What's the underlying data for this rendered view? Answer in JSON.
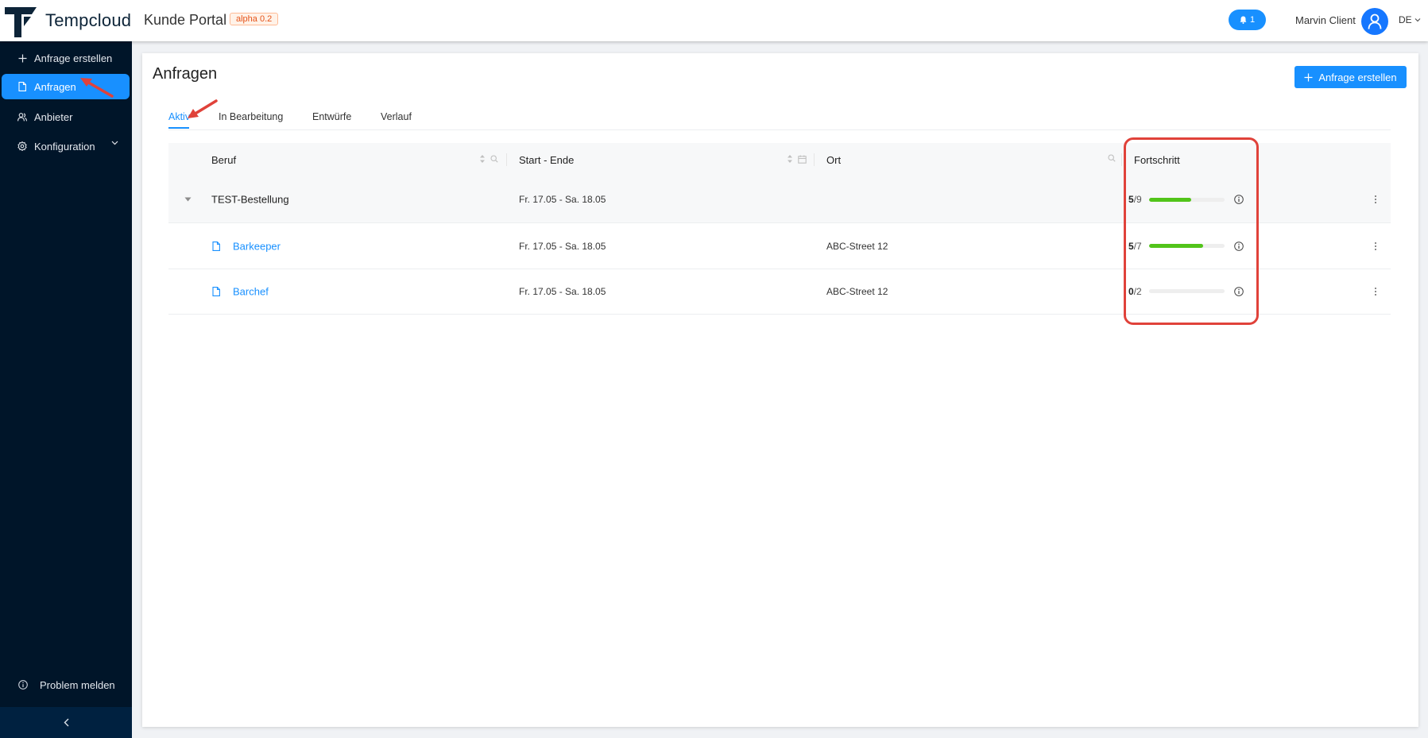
{
  "header": {
    "brand": "Tempcloud",
    "portal": "Kunde Portal",
    "version_badge": "alpha 0.2",
    "notifications_count": "1",
    "user_name": "Marvin Client",
    "language": "DE"
  },
  "sidebar": {
    "items": [
      {
        "label": "Anfrage erstellen",
        "icon": "plus-icon"
      },
      {
        "label": "Anfragen",
        "icon": "file-icon",
        "active": true
      },
      {
        "label": "Anbieter",
        "icon": "users-icon"
      },
      {
        "label": "Konfiguration",
        "icon": "gear-icon"
      }
    ],
    "report_problem": "Problem melden"
  },
  "main": {
    "title": "Anfragen",
    "create_button": "Anfrage erstellen",
    "tabs": [
      {
        "label": "Aktiv",
        "active": true
      },
      {
        "label": "In Bearbeitung"
      },
      {
        "label": "Entwürfe"
      },
      {
        "label": "Verlauf"
      }
    ],
    "table": {
      "columns": [
        "Beruf",
        "Start - Ende",
        "Ort",
        "Fortschritt"
      ],
      "group": {
        "name": "TEST-Bestellung",
        "dates": "Fr. 17.05 - Sa. 18.05",
        "progress_done": "5",
        "progress_total": "/9",
        "progress_fraction": 0.556
      },
      "rows": [
        {
          "beruf": "Barkeeper",
          "dates": "Fr. 17.05 - Sa. 18.05",
          "ort": "ABC-Street 12",
          "progress_done": "5",
          "progress_total": "/7",
          "progress_fraction": 0.714
        },
        {
          "beruf": "Barchef",
          "dates": "Fr. 17.05 - Sa. 18.05",
          "ort": "ABC-Street 12",
          "progress_done": "0",
          "progress_total": "/2",
          "progress_fraction": 0
        }
      ]
    }
  },
  "colors": {
    "accent": "#1890ff",
    "sidebar_bg": "#001529",
    "progress_green": "#52c41a",
    "annotation_red": "#e0423a"
  }
}
